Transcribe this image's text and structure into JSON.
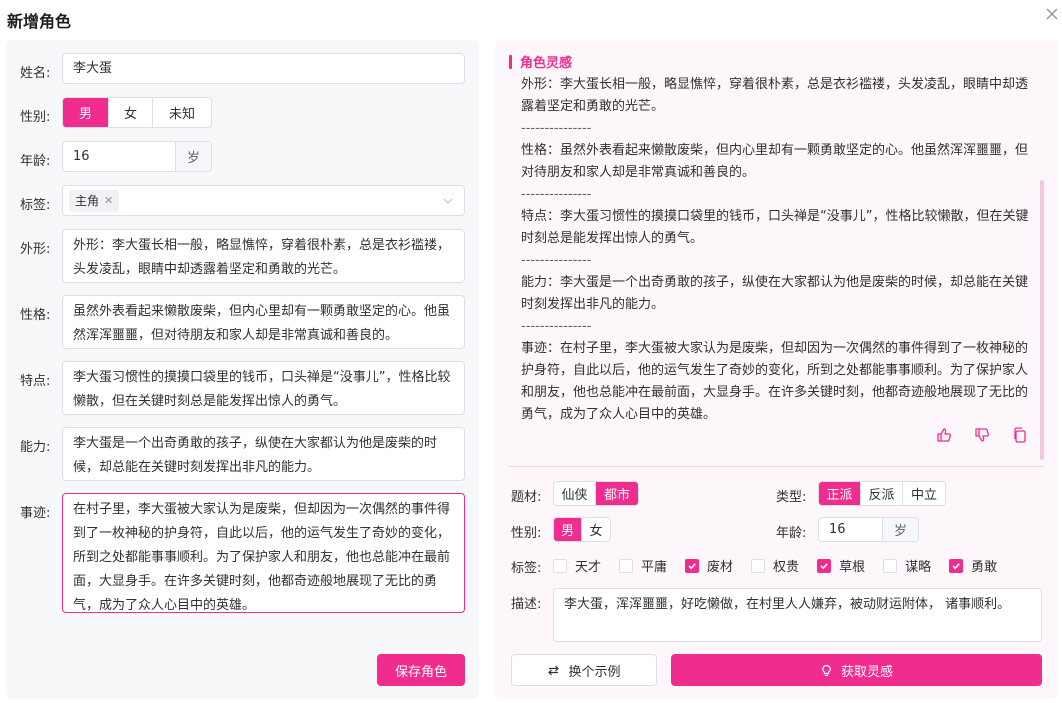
{
  "dialog": {
    "title": "新增角色"
  },
  "form": {
    "name": {
      "label": "姓名:",
      "value": "李大蛋"
    },
    "gender": {
      "label": "性别:",
      "options": [
        "男",
        "女",
        "未知"
      ],
      "selected": "男"
    },
    "age": {
      "label": "年龄:",
      "value": "16",
      "unit": "岁"
    },
    "tags": {
      "label": "标签:",
      "chips": [
        "主角"
      ]
    },
    "appearance": {
      "label": "外形:",
      "value": "外形：李大蛋长相一般，略显憔悴，穿着很朴素，总是衣衫褴褛，头发凌乱，眼睛中却透露着坚定和勇敢的光芒。"
    },
    "personality": {
      "label": "性格:",
      "value": "虽然外表看起来懒散废柴，但内心里却有一颗勇敢坚定的心。他虽然浑浑噩噩，但对待朋友和家人却是非常真诚和善良的。"
    },
    "traits": {
      "label": "特点:",
      "value": "李大蛋习惯性的摸摸口袋里的钱币，口头禅是“没事儿”，性格比较懒散，但在关键时刻总是能发挥出惊人的勇气。"
    },
    "ability": {
      "label": "能力:",
      "value": "李大蛋是一个出奇勇敢的孩子，纵使在大家都认为他是废柴的时候，却总能在关键时刻发挥出非凡的能力。"
    },
    "story": {
      "label": "事迹:",
      "value": "在村子里，李大蛋被大家认为是废柴，但却因为一次偶然的事件得到了一枚神秘的护身符，自此以后，他的运气发生了奇妙的变化，所到之处都能事事顺利。为了保护家人和朋友，他也总能冲在最前面，大显身手。在许多关键时刻，他都奇迹般地展现了无比的勇气，成为了众人心目中的英雄。"
    },
    "save_label": "保存角色"
  },
  "inspiration": {
    "title": "角色灵感",
    "paragraphs": [
      "外形：李大蛋长相一般，略显憔悴，穿着很朴素，总是衣衫褴褛，头发凌乱，眼睛中却透露着坚定和勇敢的光芒。",
      "---------------",
      "性格：虽然外表看起来懒散废柴，但内心里却有一颗勇敢坚定的心。他虽然浑浑噩噩，但对待朋友和家人却是非常真诚和善良的。",
      "---------------",
      "特点：李大蛋习惯性的摸摸口袋里的钱币，口头禅是“没事儿”，性格比较懒散，但在关键时刻总是能发挥出惊人的勇气。",
      "---------------",
      "能力：李大蛋是一个出奇勇敢的孩子，纵使在大家都认为他是废柴的时候，却总能在关键时刻发挥出非凡的能力。",
      "---------------",
      "事迹：在村子里，李大蛋被大家认为是废柴，但却因为一次偶然的事件得到了一枚神秘的护身符，自此以后，他的运气发生了奇妙的变化，所到之处都能事事顺利。为了保护家人和朋友，他也总能冲在最前面，大显身手。在许多关键时刻，他都奇迹般地展现了无比的勇气，成为了众人心目中的英雄。"
    ],
    "genre": {
      "label": "题材:",
      "options": [
        "仙侠",
        "都市"
      ],
      "selected": "都市"
    },
    "type": {
      "label": "类型:",
      "options": [
        "正派",
        "反派",
        "中立"
      ],
      "selected": "正派"
    },
    "gender": {
      "label": "性别:",
      "options": [
        "男",
        "女"
      ],
      "selected": "男"
    },
    "age": {
      "label": "年龄:",
      "value": "16",
      "unit": "岁"
    },
    "tags": {
      "label": "标签:",
      "items": [
        {
          "label": "天才",
          "checked": false
        },
        {
          "label": "平庸",
          "checked": false
        },
        {
          "label": "废材",
          "checked": true
        },
        {
          "label": "权贵",
          "checked": false
        },
        {
          "label": "草根",
          "checked": true
        },
        {
          "label": "谋略",
          "checked": false
        },
        {
          "label": "勇敢",
          "checked": true
        }
      ]
    },
    "desc": {
      "label": "描述:",
      "value": "李大蛋，浑浑噩噩，好吃懒做，在村里人人嫌弃，被动财运附体， 诸事顺利。"
    },
    "switch_label": "换个示例",
    "get_label": "获取灵感"
  },
  "colors": {
    "accent": "#f02c8e"
  }
}
